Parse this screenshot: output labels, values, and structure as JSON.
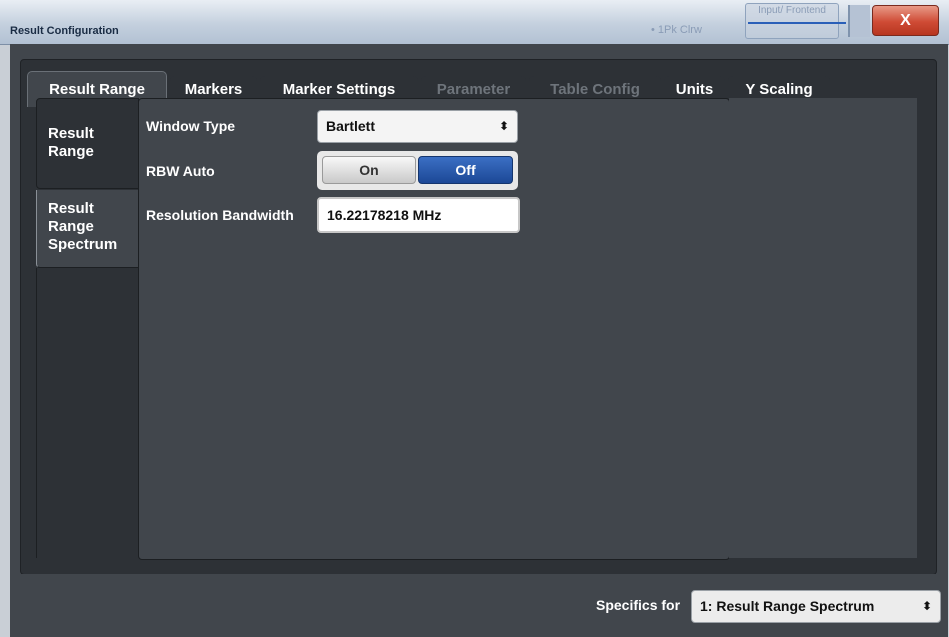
{
  "window": {
    "title": "Result Configuration",
    "close_label": "X",
    "background_info": "• 1Pk Clrw",
    "background_input": "Input/ Frontend"
  },
  "tabs": [
    {
      "label": "Result Range",
      "state": "active"
    },
    {
      "label": "Markers",
      "state": "enabled"
    },
    {
      "label": "Marker Settings",
      "state": "enabled"
    },
    {
      "label": "Parameter",
      "state": "disabled"
    },
    {
      "label": "Table Config",
      "state": "disabled"
    },
    {
      "label": "Units",
      "state": "enabled"
    },
    {
      "label": "Y Scaling",
      "state": "enabled"
    }
  ],
  "side_tabs": [
    {
      "label": "Result Range",
      "state": "inactive"
    },
    {
      "label": "Result Range Spectrum",
      "state": "active"
    }
  ],
  "form": {
    "window_type": {
      "label": "Window Type",
      "value": "Bartlett"
    },
    "rbw_auto": {
      "label": "RBW Auto",
      "on_label": "On",
      "off_label": "Off",
      "selected": "Off"
    },
    "resolution_bandwidth": {
      "label": "Resolution Bandwidth",
      "value": "16.22178218 MHz"
    }
  },
  "footer": {
    "specifics_label": "Specifics for",
    "specifics_value": "1: Result Range Spectrum"
  },
  "colors": {
    "dialog_bg": "#41464c",
    "dark_bg": "#2d3136",
    "accent_blue": "#1c4896",
    "close_red": "#cf4b35"
  }
}
